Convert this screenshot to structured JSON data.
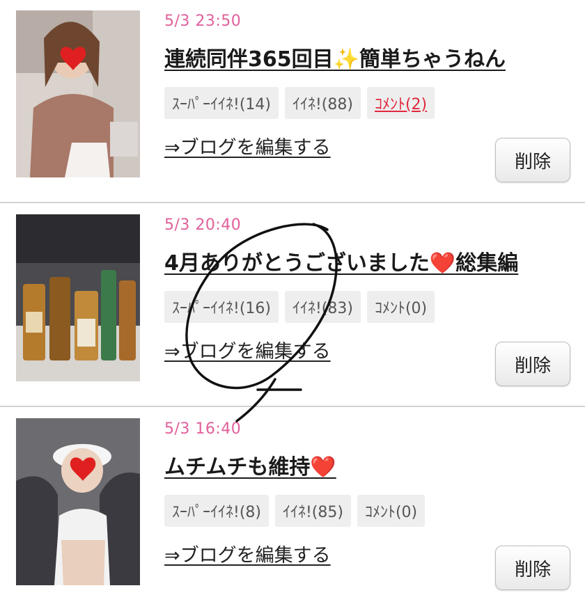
{
  "posts": [
    {
      "timestamp": "5/3 23:50",
      "title": "連続同伴365回目",
      "title_emoji": "✨",
      "title_suffix": "簡単ちゃうねん",
      "super_like": "ｽｰﾊﾟｰｲｲﾈ!(14)",
      "like": "ｲｲﾈ!(88)",
      "comment": "ｺﾒﾝﾄ(2)",
      "edit_label": "⇒ブログを編集する",
      "delete_label": "削除"
    },
    {
      "timestamp": "5/3 20:40",
      "title": "4月ありがとうございました",
      "title_emoji": "❤️",
      "title_suffix": "総集編",
      "super_like": "ｽｰﾊﾟｰｲｲﾈ!(16)",
      "like": "ｲｲﾈ!(83)",
      "comment": "ｺﾒﾝﾄ(0)",
      "edit_label": "⇒ブログを編集する",
      "delete_label": "削除"
    },
    {
      "timestamp": "5/3 16:40",
      "title": "ムチムチも維持",
      "title_emoji": "❤️",
      "title_suffix": "",
      "super_like": "ｽｰﾊﾟｰｲｲﾈ!(8)",
      "like": "ｲｲﾈ!(85)",
      "comment": "ｺﾒﾝﾄ(0)",
      "edit_label": "⇒ブログを編集する",
      "delete_label": "削除"
    }
  ],
  "colors": {
    "timestamp": "#e2609b",
    "comment_active": "#e0283c",
    "badge_bg": "#eeeeee"
  }
}
